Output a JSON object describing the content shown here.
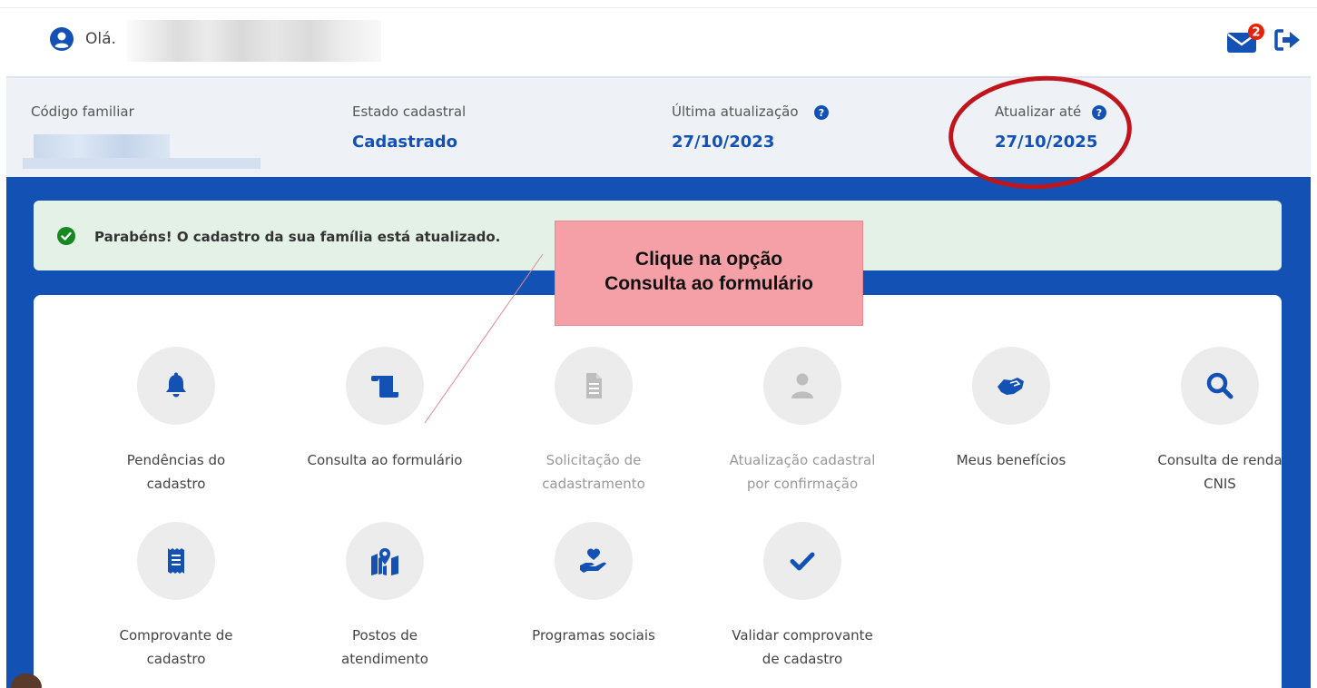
{
  "header": {
    "greeting": "Olá.",
    "mail_badge_count": "2",
    "icons": [
      "user-circle-icon",
      "mail-icon",
      "exit-icon"
    ]
  },
  "info": {
    "codigo_label": "Código familiar",
    "estado_label": "Estado cadastral",
    "estado_value": "Cadastrado",
    "ultima_label": "Última atualização",
    "ultima_value": "27/10/2023",
    "atualizar_label": "Atualizar até",
    "atualizar_value": "27/10/2025"
  },
  "alert": {
    "text": "Parabéns! O cadastro da sua família está atualizado."
  },
  "annotation": {
    "line1": "Clique na opção",
    "line2": "Consulta ao formulário"
  },
  "tiles": [
    {
      "line1": "Pendências do",
      "line2": "cadastro",
      "icon": "bell-icon",
      "enabled": true
    },
    {
      "line1": "Consulta ao formulário",
      "line2": "",
      "icon": "scroll-icon",
      "enabled": true
    },
    {
      "line1": "Solicitação de",
      "line2": "cadastramento",
      "icon": "document-icon",
      "enabled": false
    },
    {
      "line1": "Atualização cadastral",
      "line2": "por confirmação",
      "icon": "user-icon",
      "enabled": false
    },
    {
      "line1": "Meus benefícios",
      "line2": "",
      "icon": "handshake-icon",
      "enabled": true
    },
    {
      "line1": "Consulta de renda",
      "line2": "CNIS",
      "icon": "search-icon",
      "enabled": true
    },
    {
      "line1": "Comprovante de",
      "line2": "cadastro",
      "icon": "receipt-icon",
      "enabled": true
    },
    {
      "line1": "Postos de",
      "line2": "atendimento",
      "icon": "map-pin-icon",
      "enabled": true
    },
    {
      "line1": "Programas sociais",
      "line2": "",
      "icon": "hand-heart-icon",
      "enabled": true
    },
    {
      "line1": "Validar comprovante",
      "line2": "de cadastro",
      "icon": "check-icon",
      "enabled": true
    }
  ],
  "colors": {
    "primary_blue": "#1351b4",
    "success_bg": "#e3f1e6",
    "success_icon": "#168821",
    "annotation_bg": "#f4a0a6",
    "annotation_ring": "#c0151d",
    "badge_red": "#e52207"
  }
}
